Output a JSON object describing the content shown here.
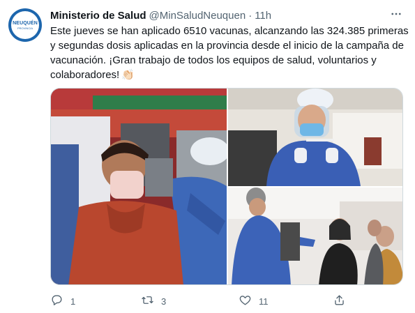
{
  "account": {
    "avatar_logo_text": "NEUQUÉN",
    "avatar_logo_subtext": "PROVINCIA",
    "display_name": "Ministerio de Salud",
    "handle": "@MinSaludNeuquen",
    "separator": "·",
    "time": "11h"
  },
  "tweet": {
    "text": "Este jueves se han aplicado 6510 vacunas, alcanzando las 324.385 primeras y segundas dosis aplicadas en la provincia desde el inicio de la campaña de vacunación. ¡Gran trabajo de todos los equipos de salud, voluntarios y colaboradores!",
    "emoji": "👏🏻"
  },
  "media": {
    "photos": [
      {
        "subject": "man in red hoodie and mask receiving vaccine from nurse in blue gown"
      },
      {
        "subject": "nurse in face shield and hairnet preparing syringe"
      },
      {
        "subject": "health worker in blue gown talking to seated people in masks"
      }
    ]
  },
  "actions": {
    "reply_count": "1",
    "retweet_count": "3",
    "like_count": "11"
  },
  "colors": {
    "text": "#0f1419",
    "secondary": "#536471",
    "brand_blue": "#1d66ad",
    "border": "#cfd9de"
  }
}
